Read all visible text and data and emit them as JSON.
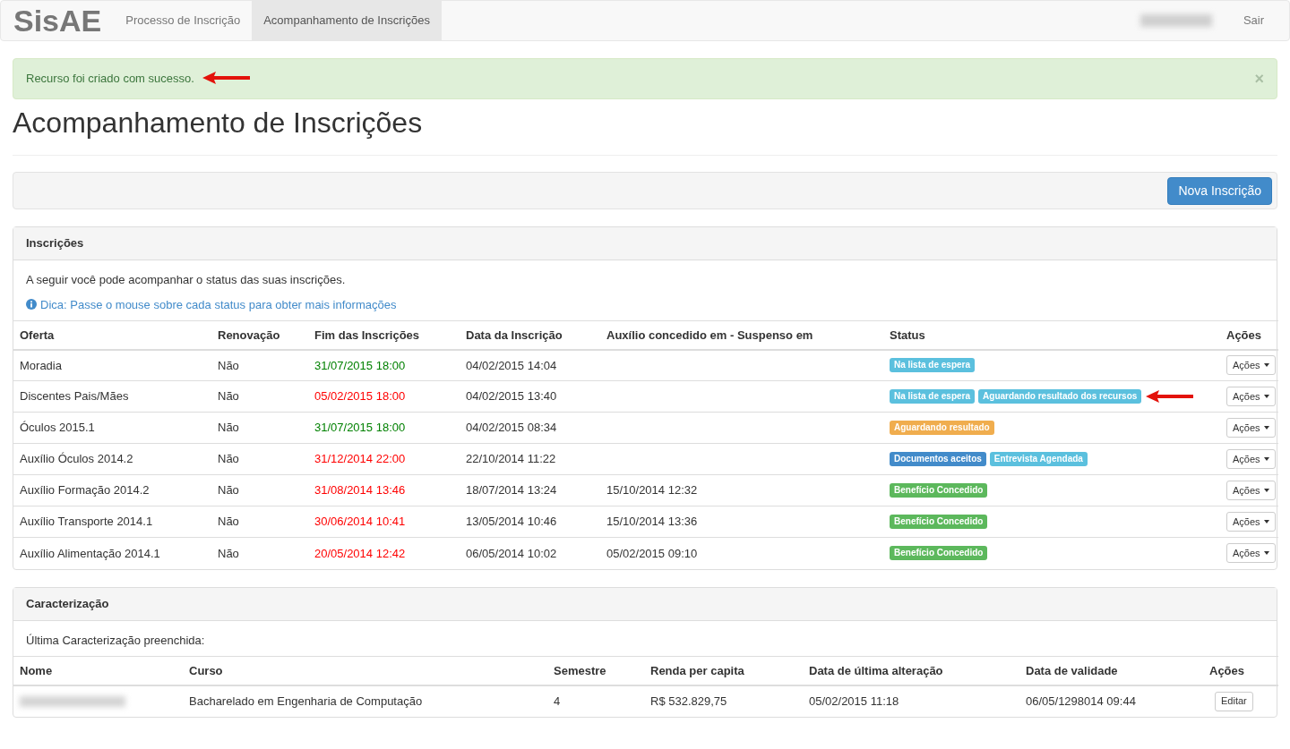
{
  "navbar": {
    "brand": "SisAE",
    "links": [
      {
        "label": "Processo de Inscrição",
        "selected": false
      },
      {
        "label": "Acompanhamento de Inscrições",
        "selected": true
      }
    ],
    "user_redacted": true,
    "logout": "Sair"
  },
  "alert": {
    "message": "Recurso foi criado com sucesso.",
    "close": "×",
    "arrow_marked": true
  },
  "title": "Acompanhamento de Inscrições",
  "toolbar": {
    "button": "Nova Inscrição"
  },
  "inscricoes": {
    "heading": "Inscrições",
    "intro": "A seguir você pode acompanhar o status das suas inscrições.",
    "tip": "Dica: Passe o mouse sobre cada status para obter mais informações",
    "columns": [
      "Oferta",
      "Renovação",
      "Fim das Inscrições",
      "Data da Inscrição",
      "Auxílio concedido em - Suspenso em",
      "Status",
      "Ações"
    ],
    "rows": [
      {
        "oferta": "Moradia",
        "renovacao": "Não",
        "fim": {
          "text": "31/07/2015 18:00",
          "color": "#008000"
        },
        "data": "04/02/2015 14:04",
        "status": [
          {
            "label": "Na lista de espera",
            "kind": "info"
          }
        ],
        "arrow_marked": false,
        "action": "Ações"
      },
      {
        "oferta": "Discentes Pais/Mães",
        "renovacao": "Não",
        "fim": {
          "text": "05/02/2015 18:00",
          "color": "#ff0000"
        },
        "data": "04/02/2015 13:40",
        "status": [
          {
            "label": "Na lista de espera",
            "kind": "info"
          },
          {
            "label": "Aguardando resultado dos recursos",
            "kind": "info"
          }
        ],
        "arrow_marked": true,
        "action": "Ações"
      },
      {
        "oferta": "Óculos 2015.1",
        "renovacao": "Não",
        "fim": {
          "text": "31/07/2015 18:00",
          "color": "#008000"
        },
        "data": "04/02/2015 08:34",
        "status": [
          {
            "label": "Aguardando resultado",
            "kind": "warning"
          }
        ],
        "arrow_marked": false,
        "action": "Ações"
      },
      {
        "oferta": "Auxílio Óculos 2014.2",
        "renovacao": "Não",
        "fim": {
          "text": "31/12/2014 22:00",
          "color": "#ff0000"
        },
        "data": "22/10/2014 11:22",
        "status": [
          {
            "label": "Documentos aceitos",
            "kind": "primary"
          },
          {
            "label": "Entrevista Agendada",
            "kind": "info"
          }
        ],
        "arrow_marked": false,
        "action": "Ações"
      },
      {
        "oferta": "Auxílio Formação 2014.2",
        "renovacao": "Não",
        "fim": {
          "text": "31/08/2014 13:46",
          "color": "#ff0000"
        },
        "data": "18/07/2014 13:24",
        "auxilio": "15/10/2014 12:32",
        "status": [
          {
            "label": "Benefício Concedido",
            "kind": "success"
          }
        ],
        "arrow_marked": false,
        "action": "Ações"
      },
      {
        "oferta": "Auxílio Transporte 2014.1",
        "renovacao": "Não",
        "fim": {
          "text": "30/06/2014 10:41",
          "color": "#ff0000"
        },
        "data": "13/05/2014 10:46",
        "auxilio": "15/10/2014 13:36",
        "status": [
          {
            "label": "Benefício Concedido",
            "kind": "success"
          }
        ],
        "arrow_marked": false,
        "action": "Ações"
      },
      {
        "oferta": "Auxílio Alimentação 2014.1",
        "renovacao": "Não",
        "fim": {
          "text": "20/05/2014 12:42",
          "color": "#ff0000"
        },
        "data": "06/05/2014 10:02",
        "auxilio": "05/02/2015 09:10",
        "status": [
          {
            "label": "Benefício Concedido",
            "kind": "success"
          }
        ],
        "arrow_marked": false,
        "action": "Ações"
      }
    ]
  },
  "caracterizacao": {
    "heading": "Caracterização",
    "intro": "Última Caracterização preenchida:",
    "columns": [
      "Nome",
      "Curso",
      "Semestre",
      "Renda per capita",
      "Data de última alteração",
      "Data de validade",
      "Ações"
    ],
    "rows": [
      {
        "nome_redacted": true,
        "curso": "Bacharelado em Engenharia de Computação",
        "semestre": "4",
        "renda": "R$ 532.829,75",
        "alteracao": "05/02/2015 11:18",
        "validade": "06/05/1298014 09:44",
        "action": "Editar"
      }
    ]
  }
}
